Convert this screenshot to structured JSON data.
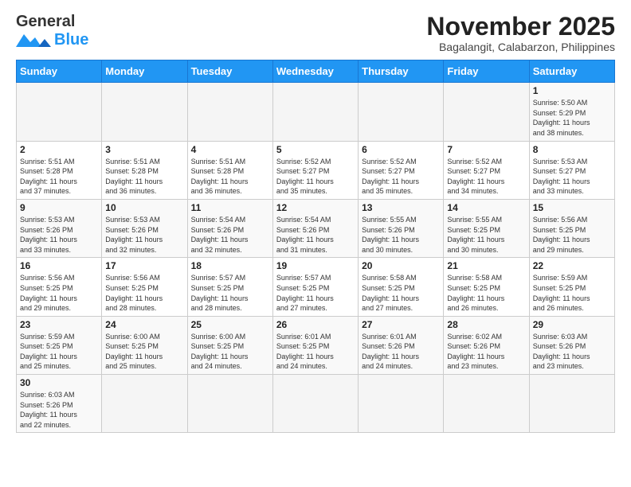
{
  "logo": {
    "line1": "General",
    "line2": "Blue"
  },
  "title": "November 2025",
  "subtitle": "Bagalangit, Calabarzon, Philippines",
  "days_of_week": [
    "Sunday",
    "Monday",
    "Tuesday",
    "Wednesday",
    "Thursday",
    "Friday",
    "Saturday"
  ],
  "weeks": [
    [
      {
        "day": "",
        "info": ""
      },
      {
        "day": "",
        "info": ""
      },
      {
        "day": "",
        "info": ""
      },
      {
        "day": "",
        "info": ""
      },
      {
        "day": "",
        "info": ""
      },
      {
        "day": "",
        "info": ""
      },
      {
        "day": "1",
        "info": "Sunrise: 5:50 AM\nSunset: 5:29 PM\nDaylight: 11 hours\nand 38 minutes."
      }
    ],
    [
      {
        "day": "2",
        "info": "Sunrise: 5:51 AM\nSunset: 5:28 PM\nDaylight: 11 hours\nand 37 minutes."
      },
      {
        "day": "3",
        "info": "Sunrise: 5:51 AM\nSunset: 5:28 PM\nDaylight: 11 hours\nand 36 minutes."
      },
      {
        "day": "4",
        "info": "Sunrise: 5:51 AM\nSunset: 5:28 PM\nDaylight: 11 hours\nand 36 minutes."
      },
      {
        "day": "5",
        "info": "Sunrise: 5:52 AM\nSunset: 5:27 PM\nDaylight: 11 hours\nand 35 minutes."
      },
      {
        "day": "6",
        "info": "Sunrise: 5:52 AM\nSunset: 5:27 PM\nDaylight: 11 hours\nand 35 minutes."
      },
      {
        "day": "7",
        "info": "Sunrise: 5:52 AM\nSunset: 5:27 PM\nDaylight: 11 hours\nand 34 minutes."
      },
      {
        "day": "8",
        "info": "Sunrise: 5:53 AM\nSunset: 5:27 PM\nDaylight: 11 hours\nand 33 minutes."
      }
    ],
    [
      {
        "day": "9",
        "info": "Sunrise: 5:53 AM\nSunset: 5:26 PM\nDaylight: 11 hours\nand 33 minutes."
      },
      {
        "day": "10",
        "info": "Sunrise: 5:53 AM\nSunset: 5:26 PM\nDaylight: 11 hours\nand 32 minutes."
      },
      {
        "day": "11",
        "info": "Sunrise: 5:54 AM\nSunset: 5:26 PM\nDaylight: 11 hours\nand 32 minutes."
      },
      {
        "day": "12",
        "info": "Sunrise: 5:54 AM\nSunset: 5:26 PM\nDaylight: 11 hours\nand 31 minutes."
      },
      {
        "day": "13",
        "info": "Sunrise: 5:55 AM\nSunset: 5:26 PM\nDaylight: 11 hours\nand 30 minutes."
      },
      {
        "day": "14",
        "info": "Sunrise: 5:55 AM\nSunset: 5:25 PM\nDaylight: 11 hours\nand 30 minutes."
      },
      {
        "day": "15",
        "info": "Sunrise: 5:56 AM\nSunset: 5:25 PM\nDaylight: 11 hours\nand 29 minutes."
      }
    ],
    [
      {
        "day": "16",
        "info": "Sunrise: 5:56 AM\nSunset: 5:25 PM\nDaylight: 11 hours\nand 29 minutes."
      },
      {
        "day": "17",
        "info": "Sunrise: 5:56 AM\nSunset: 5:25 PM\nDaylight: 11 hours\nand 28 minutes."
      },
      {
        "day": "18",
        "info": "Sunrise: 5:57 AM\nSunset: 5:25 PM\nDaylight: 11 hours\nand 28 minutes."
      },
      {
        "day": "19",
        "info": "Sunrise: 5:57 AM\nSunset: 5:25 PM\nDaylight: 11 hours\nand 27 minutes."
      },
      {
        "day": "20",
        "info": "Sunrise: 5:58 AM\nSunset: 5:25 PM\nDaylight: 11 hours\nand 27 minutes."
      },
      {
        "day": "21",
        "info": "Sunrise: 5:58 AM\nSunset: 5:25 PM\nDaylight: 11 hours\nand 26 minutes."
      },
      {
        "day": "22",
        "info": "Sunrise: 5:59 AM\nSunset: 5:25 PM\nDaylight: 11 hours\nand 26 minutes."
      }
    ],
    [
      {
        "day": "23",
        "info": "Sunrise: 5:59 AM\nSunset: 5:25 PM\nDaylight: 11 hours\nand 25 minutes."
      },
      {
        "day": "24",
        "info": "Sunrise: 6:00 AM\nSunset: 5:25 PM\nDaylight: 11 hours\nand 25 minutes."
      },
      {
        "day": "25",
        "info": "Sunrise: 6:00 AM\nSunset: 5:25 PM\nDaylight: 11 hours\nand 24 minutes."
      },
      {
        "day": "26",
        "info": "Sunrise: 6:01 AM\nSunset: 5:25 PM\nDaylight: 11 hours\nand 24 minutes."
      },
      {
        "day": "27",
        "info": "Sunrise: 6:01 AM\nSunset: 5:26 PM\nDaylight: 11 hours\nand 24 minutes."
      },
      {
        "day": "28",
        "info": "Sunrise: 6:02 AM\nSunset: 5:26 PM\nDaylight: 11 hours\nand 23 minutes."
      },
      {
        "day": "29",
        "info": "Sunrise: 6:03 AM\nSunset: 5:26 PM\nDaylight: 11 hours\nand 23 minutes."
      }
    ],
    [
      {
        "day": "30",
        "info": "Sunrise: 6:03 AM\nSunset: 5:26 PM\nDaylight: 11 hours\nand 22 minutes."
      },
      {
        "day": "",
        "info": ""
      },
      {
        "day": "",
        "info": ""
      },
      {
        "day": "",
        "info": ""
      },
      {
        "day": "",
        "info": ""
      },
      {
        "day": "",
        "info": ""
      },
      {
        "day": "",
        "info": ""
      }
    ]
  ]
}
